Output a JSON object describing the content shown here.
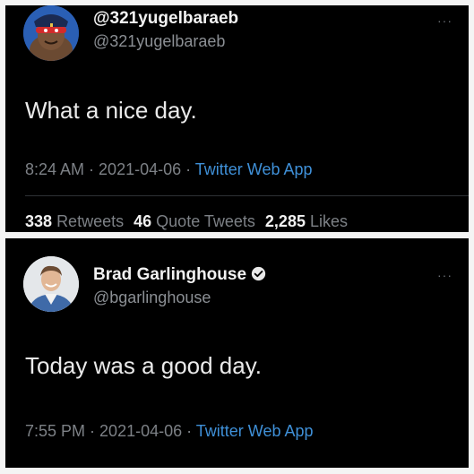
{
  "tweet1": {
    "display_name": "@321yugelbaraeb",
    "handle": "@321yugelbaraeb",
    "more": "···",
    "text": "What a nice day.",
    "time": "8:24 AM",
    "date": "2021-04-06",
    "source": "Twitter Web App",
    "stats": {
      "retweets_count": "338",
      "retweets_label": "Retweets",
      "quotes_count": "46",
      "quotes_label": "Quote Tweets",
      "likes_count": "2,285",
      "likes_label": "Likes"
    }
  },
  "tweet2": {
    "display_name": "Brad Garlinghouse",
    "handle": "@bgarlinghouse",
    "more": "···",
    "text": "Today was a good day.",
    "time": "7:55 PM",
    "date": "2021-04-06",
    "source": "Twitter Web App"
  },
  "separator": " · ",
  "colors": {
    "background": "#000000",
    "text": "#eaeaea",
    "muted": "#7d8186",
    "link": "#3f90d8"
  }
}
